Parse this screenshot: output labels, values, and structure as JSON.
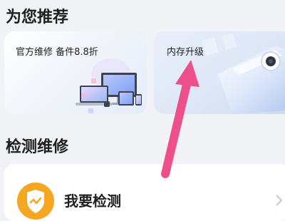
{
  "recommend": {
    "title": "为您推荐",
    "cards": [
      {
        "label": "官方维修  备件8.8折"
      },
      {
        "label": "内存升级"
      }
    ]
  },
  "repair": {
    "title": "检测维修",
    "items": [
      {
        "label": "我要检测",
        "icon": "shield-check-icon"
      }
    ]
  },
  "colors": {
    "accent_orange": "#f5a623",
    "annotation_arrow": "#ec4f8a",
    "background": "#f1f3f6"
  }
}
